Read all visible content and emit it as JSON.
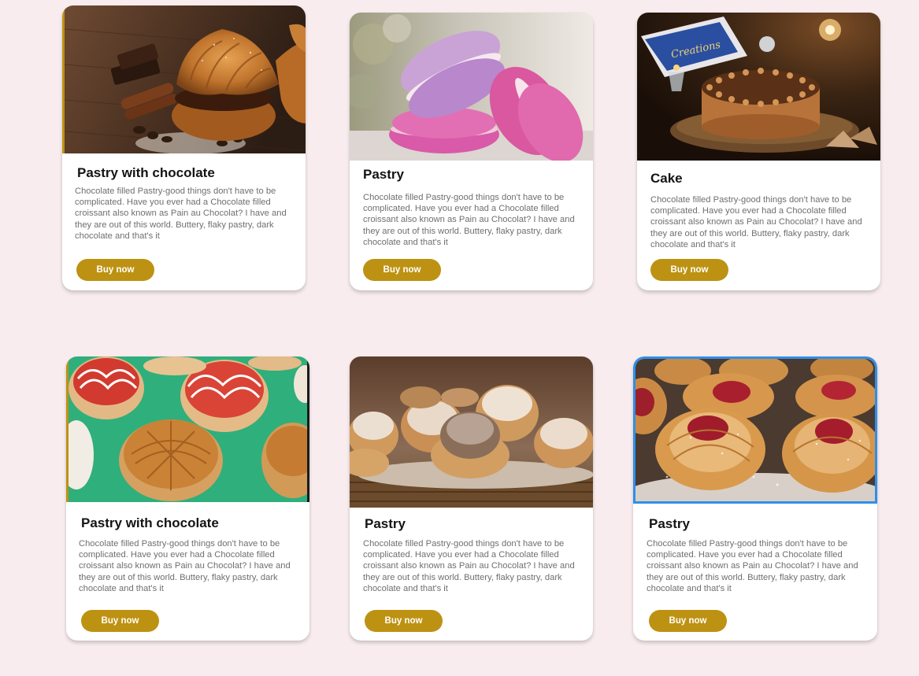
{
  "products": [
    {
      "title": "Pastry with chocolate",
      "description": "Chocolate filled Pastry-good things don't have to be complicated. Have you ever had a Chocolate filled croissant also known as Pain au Chocolat? I have and they are out of this world. Buttery, flaky pastry, dark chocolate and that's it",
      "button_label": "Buy now",
      "image": "croissant-chocolate-photo"
    },
    {
      "title": "Pastry",
      "description": "Chocolate filled Pastry-good things don't have to be complicated. Have you ever had a Chocolate filled croissant also known as Pain au Chocolat? I have and they are out of this world. Buttery, flaky pastry, dark chocolate and that's it",
      "button_label": "Buy now",
      "image": "macarons-photo"
    },
    {
      "title": "Cake",
      "description": "Chocolate filled Pastry-good things don't have to be complicated. Have you ever had a Chocolate filled croissant also known as Pain au Chocolat? I have and they are out of this world. Buttery, flaky pastry, dark chocolate and that's it",
      "button_label": "Buy now",
      "image": "chocolate-cake-photo",
      "box_text": "Creations"
    },
    {
      "title": "Pastry with chocolate",
      "description": "Chocolate filled Pastry-good things don't have to be complicated. Have you ever had a Chocolate filled croissant also known as Pain au Chocolat? I have and they are out of this world. Buttery, flaky pastry, dark chocolate and that's it",
      "button_label": "Buy now",
      "image": "glazed-buns-photo"
    },
    {
      "title": "Pastry",
      "description": "Chocolate filled Pastry-good things don't have to be complicated. Have you ever had a Chocolate filled croissant also known as Pain au Chocolat? I have and they are out of this world. Buttery, flaky pastry, dark chocolate and that's it",
      "button_label": "Buy now",
      "image": "sugar-dusted-rolls-photo"
    },
    {
      "title": "Pastry",
      "description": "Chocolate filled Pastry-good things don't have to be complicated. Have you ever had a Chocolate filled croissant also known as Pain au Chocolat? I have and they are out of this world. Buttery, flaky pastry, dark chocolate and that's it",
      "button_label": "Buy now",
      "image": "cherry-danish-photo"
    }
  ],
  "colors": {
    "page_background": "#f8ecee",
    "card_background": "#ffffff",
    "button": "#bd9213",
    "button_text": "#ffffff",
    "title_text": "#141414",
    "description_text": "#6f6f6f",
    "selected_border": "#2f8fe8"
  }
}
